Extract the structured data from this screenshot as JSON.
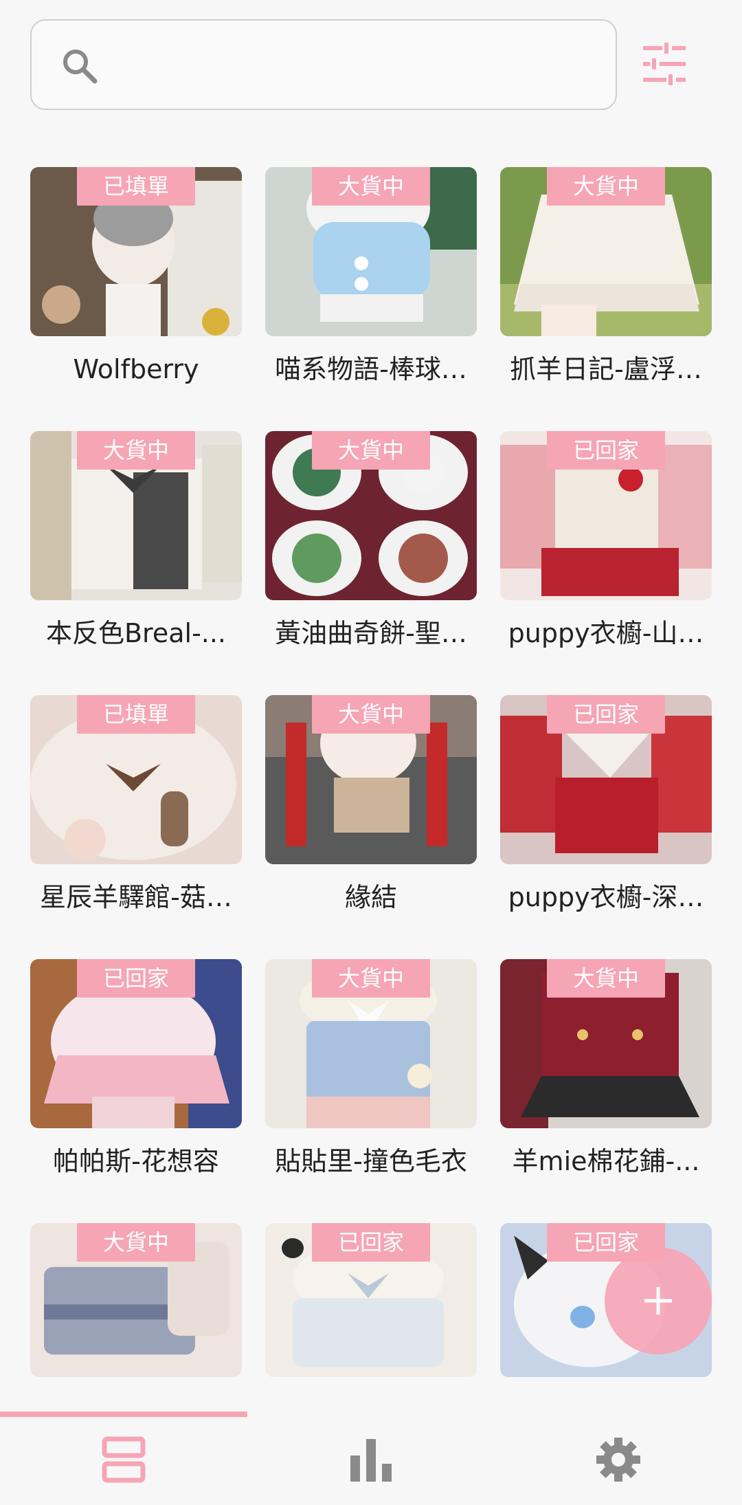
{
  "colors": {
    "accent": "#f6a5b5",
    "icon_gray": "#8a8a8a",
    "background": "#f7f7f8"
  },
  "search": {
    "placeholder": "",
    "icon": "search-icon"
  },
  "filter": {
    "icon": "tune-icon"
  },
  "items": [
    {
      "status": "已填單",
      "title": "Wolfberry"
    },
    {
      "status": "大貨中",
      "title": "喵系物語-棒球…"
    },
    {
      "status": "大貨中",
      "title": "抓羊日記-盧浮…"
    },
    {
      "status": "大貨中",
      "title": "本反色Breal-..."
    },
    {
      "status": "大貨中",
      "title": "黃油曲奇餅-聖…"
    },
    {
      "status": "已回家",
      "title": "puppy衣櫥-山…"
    },
    {
      "status": "已填單",
      "title": "星辰羊驛館-菇…"
    },
    {
      "status": "大貨中",
      "title": "緣結"
    },
    {
      "status": "已回家",
      "title": "puppy衣櫥-深…"
    },
    {
      "status": "已回家",
      "title": "帕帕斯-花想容"
    },
    {
      "status": "大貨中",
      "title": "貼貼里-撞色毛衣"
    },
    {
      "status": "大貨中",
      "title": "羊mie棉花鋪-..."
    },
    {
      "status": "大貨中",
      "title": ""
    },
    {
      "status": "已回家",
      "title": ""
    },
    {
      "status": "已回家",
      "title": ""
    }
  ],
  "fab": {
    "icon": "plus-icon"
  },
  "bottom_nav": [
    {
      "icon": "list-icon",
      "active": true
    },
    {
      "icon": "bar-chart-icon",
      "active": false
    },
    {
      "icon": "gear-icon",
      "active": false
    }
  ]
}
